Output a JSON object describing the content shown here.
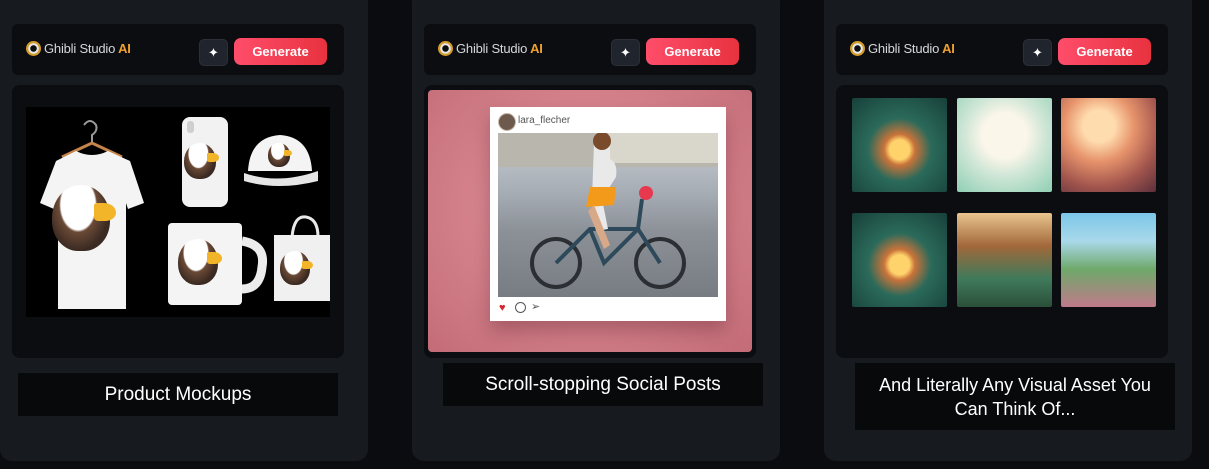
{
  "cards": [
    {
      "brand": {
        "name": "Ghibli Studio",
        "ai": "AI"
      },
      "spark_glyph": "✦",
      "generate_label": "Generate",
      "caption": "Product Mockups"
    },
    {
      "brand": {
        "name": "Ghibli Studio",
        "ai": "AI"
      },
      "spark_glyph": "✦",
      "generate_label": "Generate",
      "caption": "Scroll-stopping Social Posts",
      "post": {
        "username": "lara_flecher"
      }
    },
    {
      "brand": {
        "name": "Ghibli Studio",
        "ai": "AI"
      },
      "spark_glyph": "✦",
      "generate_label": "Generate",
      "caption": "And Literally Any Visual Asset You Can Think Of..."
    }
  ],
  "colors": {
    "page_bg": "#0a0c10",
    "card_bg": "#171a1f",
    "generate_gradient_start": "#ff4d6a",
    "generate_gradient_end": "#e8323f",
    "brand_ai": "#f0a02e",
    "social_bg": "#d3808a"
  },
  "icons": [
    "ghibli-logo-icon",
    "sparkle-icon",
    "heart-icon",
    "comment-icon",
    "send-icon"
  ]
}
